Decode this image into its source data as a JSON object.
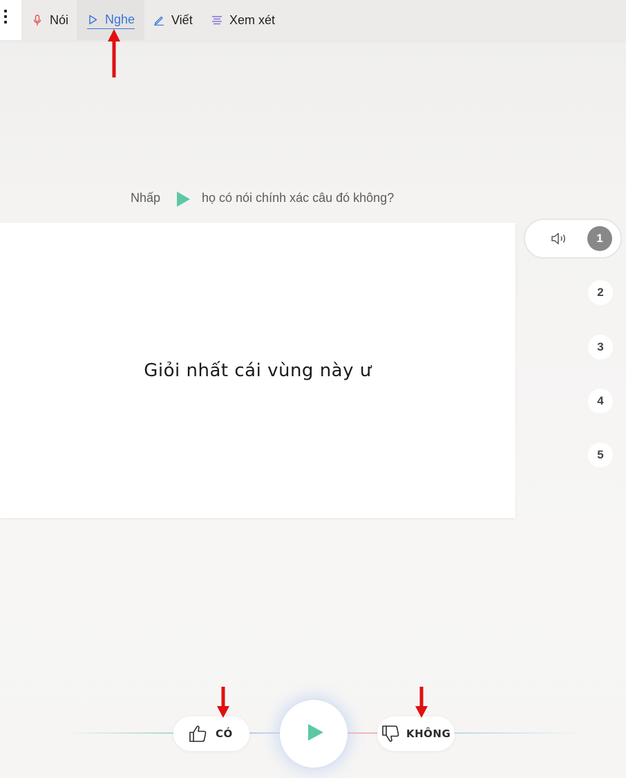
{
  "nav": {
    "tabs": [
      {
        "label": "Nói",
        "icon": "microphone-icon",
        "active": false
      },
      {
        "label": "Nghe",
        "icon": "play-icon",
        "active": true
      },
      {
        "label": "Viết",
        "icon": "pencil-icon",
        "active": false
      },
      {
        "label": "Xem xét",
        "icon": "list-icon",
        "active": false
      }
    ],
    "menu_icon": "kebab-menu-icon"
  },
  "instruction": {
    "prefix": "Nhấp",
    "suffix": "họ có nói chính xác câu đó không?"
  },
  "card": {
    "sentence": "Giỏi nhất cái vùng này ư"
  },
  "clips": {
    "items": [
      "1",
      "2",
      "3",
      "4",
      "5"
    ],
    "active": "1"
  },
  "controls": {
    "yes_label": "CÓ",
    "no_label": "KHÔNG"
  },
  "colors": {
    "accent_blue": "#3b74d9",
    "play_green": "#5cc8a6",
    "annotation_red": "#e01010",
    "mic_red": "#e05555",
    "list_purple": "#7a6ad8"
  }
}
